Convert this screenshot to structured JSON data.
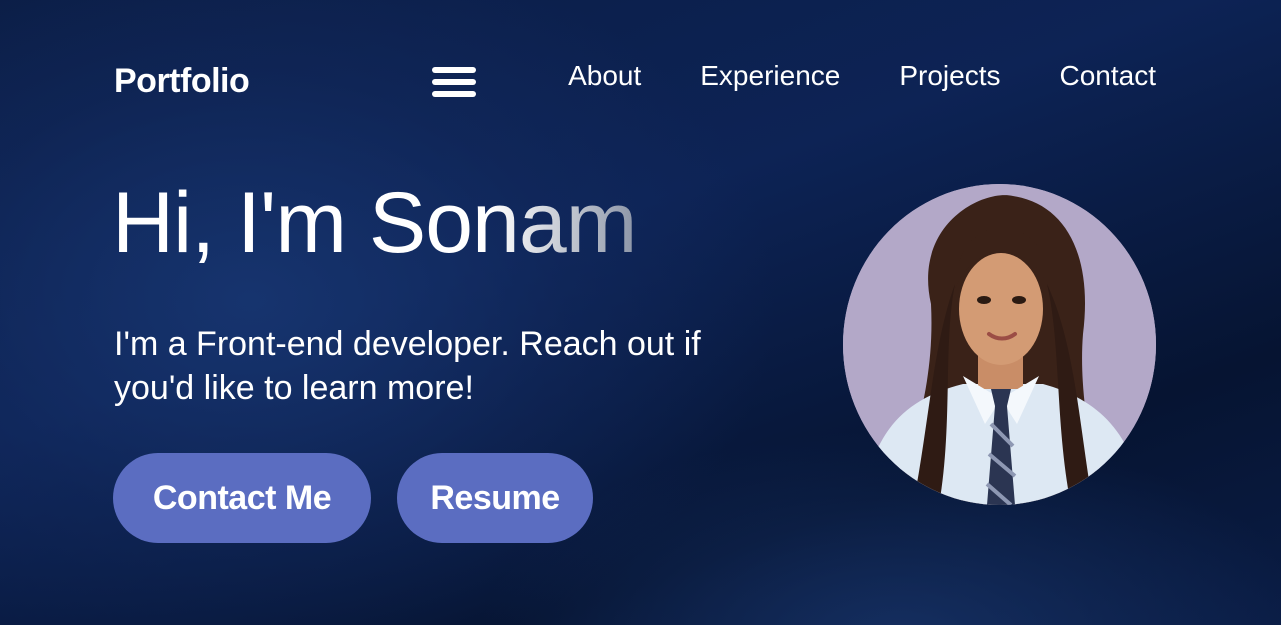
{
  "navbar": {
    "brand": "Portfolio",
    "menu_icon": "hamburger-menu-icon",
    "links": [
      "About",
      "Experience",
      "Projects",
      "Contact"
    ]
  },
  "hero": {
    "title": "Hi, I'm Sonam",
    "description": "I'm a Front-end developer. Reach out if you'd like to learn more!",
    "buttons": {
      "contact": "Contact Me",
      "resume": "Resume"
    }
  },
  "colors": {
    "background": "#0c2150",
    "button": "#5b6dc1",
    "text": "#ffffff",
    "avatar_background": "#b3a8c8"
  }
}
